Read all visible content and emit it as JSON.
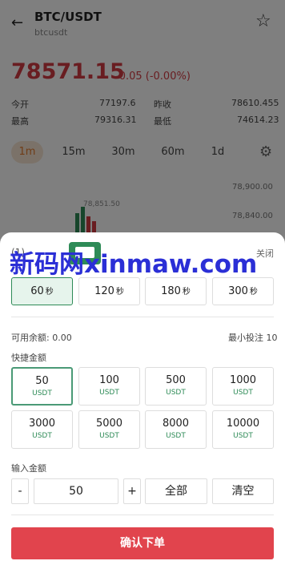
{
  "header": {
    "title": "BTC/USDT",
    "subtitle": "btcusdt"
  },
  "ticker": {
    "price": "78571.15",
    "change": "-0.05 (-0.00%)"
  },
  "stats": {
    "open_label": "今开",
    "open_value": "77197.6",
    "prev_label": "昨收",
    "prev_value": "78610.455",
    "high_label": "最高",
    "high_value": "79316.31",
    "low_label": "最低",
    "low_value": "74614.23"
  },
  "timeframes": [
    "1m",
    "15m",
    "30m",
    "60m",
    "1d"
  ],
  "chart": {
    "y_labels": [
      "78,900.00",
      "78,840.00"
    ],
    "last_price": "78,851.50"
  },
  "sheet": {
    "title_hint": "(1)",
    "close": "关闭",
    "durations": [
      {
        "value": "60",
        "unit": "秒"
      },
      {
        "value": "120",
        "unit": "秒"
      },
      {
        "value": "180",
        "unit": "秒"
      },
      {
        "value": "300",
        "unit": "秒"
      }
    ],
    "available_label": "可用余额: 0.00",
    "min_label": "最小投注 10",
    "quick_label": "快捷金额",
    "amounts": [
      {
        "value": "50",
        "unit": "USDT"
      },
      {
        "value": "100",
        "unit": "USDT"
      },
      {
        "value": "500",
        "unit": "USDT"
      },
      {
        "value": "1000",
        "unit": "USDT"
      },
      {
        "value": "3000",
        "unit": "USDT"
      },
      {
        "value": "5000",
        "unit": "USDT"
      },
      {
        "value": "8000",
        "unit": "USDT"
      },
      {
        "value": "10000",
        "unit": "USDT"
      }
    ],
    "input_label": "输入金额",
    "minus": "-",
    "amount_value": "50",
    "plus": "+",
    "all": "全部",
    "clear": "清空",
    "confirm": "确认下单"
  },
  "watermark": "新码网xinmaw.com"
}
